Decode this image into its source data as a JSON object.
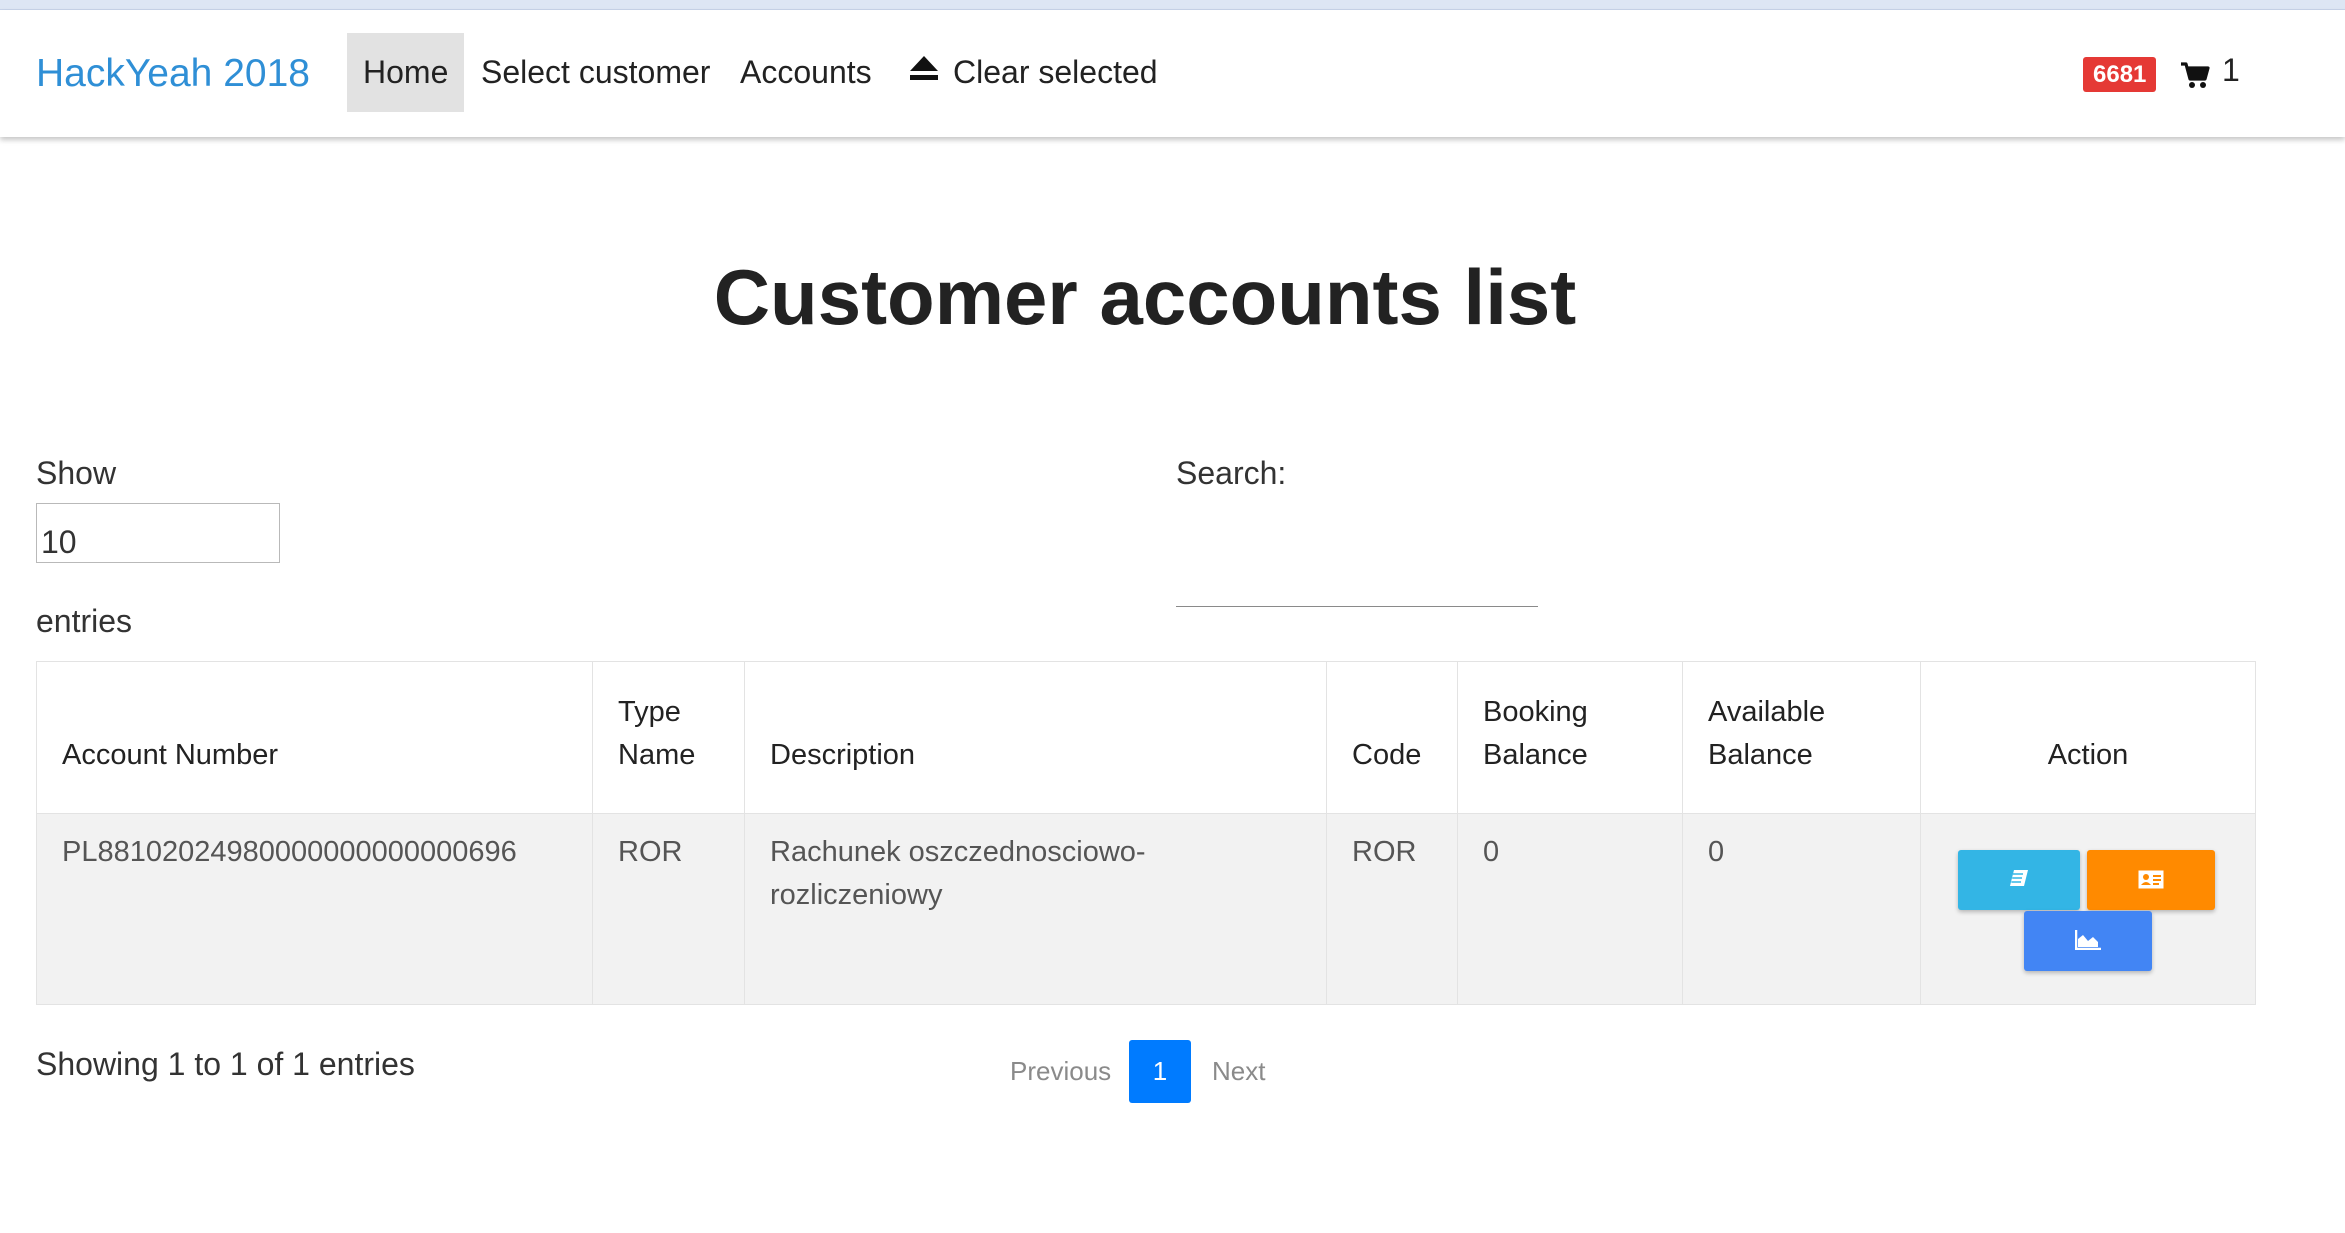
{
  "navbar": {
    "brand": "HackYeah 2018",
    "items": [
      {
        "label": "Home"
      },
      {
        "label": "Select customer"
      },
      {
        "label": "Accounts"
      },
      {
        "label": "Clear selected"
      }
    ],
    "badge": "6681",
    "cart_count": "1"
  },
  "page": {
    "title": "Customer accounts list"
  },
  "controls": {
    "show_label": "Show",
    "show_value": "10",
    "entries_label": "entries",
    "search_label": "Search:",
    "search_value": ""
  },
  "table": {
    "headers": {
      "account_number": "Account Number",
      "type_name": "Type Name",
      "description": "Description",
      "code": "Code",
      "booking_balance": "Booking Balance",
      "available_balance": "Available Balance",
      "action": "Action"
    },
    "rows": [
      {
        "account_number": "PL88102024980000000000000696",
        "type_name": "ROR",
        "description": "Rachunek oszczednosciowo-rozliczeniowy",
        "code": "ROR",
        "booking_balance": "0",
        "available_balance": "0"
      }
    ],
    "action_icons": [
      "book-icon",
      "id-card-icon",
      "area-chart-icon"
    ]
  },
  "footer": {
    "info": "Showing 1 to 1 of 1 entries",
    "previous": "Previous",
    "page": "1",
    "next": "Next"
  },
  "colors": {
    "brand": "#2f8fd6",
    "badge": "#e53935",
    "btn_book": "#33b5e5",
    "btn_card": "#ff8a00",
    "btn_chart": "#4285f4",
    "page_active": "#007bff"
  }
}
